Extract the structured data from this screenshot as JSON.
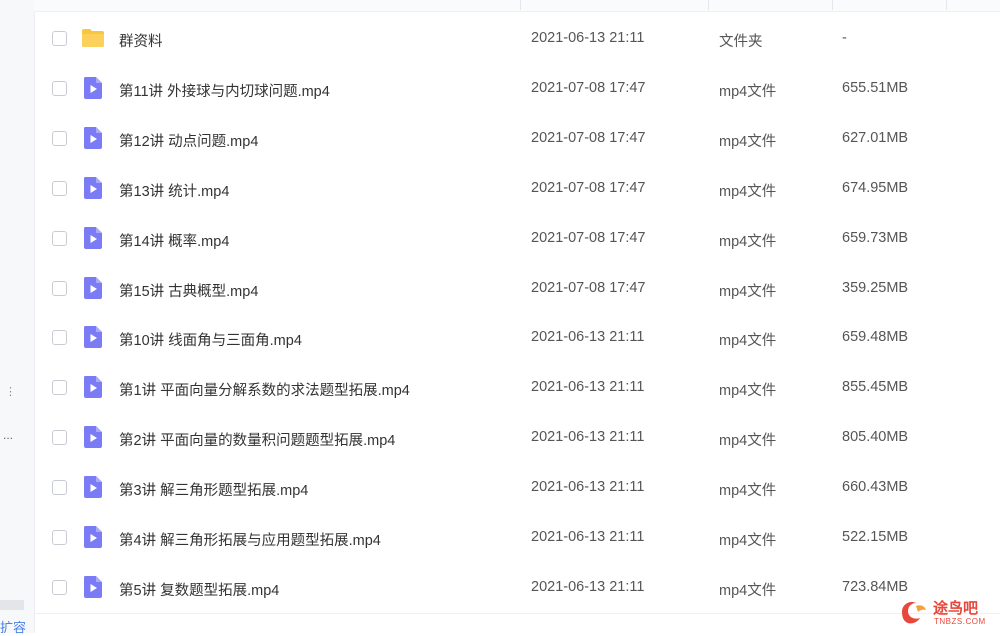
{
  "sidebar": {
    "dots": "⋮",
    "ellipsis": "...",
    "bottom_label": "扩容"
  },
  "files": [
    {
      "name": "群资料",
      "date": "2021-06-13 21:11",
      "type": "文件夹",
      "size": "-",
      "icon": "folder-icon"
    },
    {
      "name": "第11讲 外接球与内切球问题.mp4",
      "date": "2021-07-08 17:47",
      "type": "mp4文件",
      "size": "655.51MB",
      "icon": "video-file-icon"
    },
    {
      "name": "第12讲 动点问题.mp4",
      "date": "2021-07-08 17:47",
      "type": "mp4文件",
      "size": "627.01MB",
      "icon": "video-file-icon"
    },
    {
      "name": "第13讲 统计.mp4",
      "date": "2021-07-08 17:47",
      "type": "mp4文件",
      "size": "674.95MB",
      "icon": "video-file-icon"
    },
    {
      "name": "第14讲 概率.mp4",
      "date": "2021-07-08 17:47",
      "type": "mp4文件",
      "size": "659.73MB",
      "icon": "video-file-icon"
    },
    {
      "name": "第15讲 古典概型.mp4",
      "date": "2021-07-08 17:47",
      "type": "mp4文件",
      "size": "359.25MB",
      "icon": "video-file-icon"
    },
    {
      "name": "第10讲 线面角与三面角.mp4",
      "date": "2021-06-13 21:11",
      "type": "mp4文件",
      "size": "659.48MB",
      "icon": "video-file-icon"
    },
    {
      "name": "第1讲 平面向量分解系数的求法题型拓展.mp4",
      "date": "2021-06-13 21:11",
      "type": "mp4文件",
      "size": "855.45MB",
      "icon": "video-file-icon"
    },
    {
      "name": "第2讲 平面向量的数量积问题题型拓展.mp4",
      "date": "2021-06-13 21:11",
      "type": "mp4文件",
      "size": "805.40MB",
      "icon": "video-file-icon"
    },
    {
      "name": "第3讲 解三角形题型拓展.mp4",
      "date": "2021-06-13 21:11",
      "type": "mp4文件",
      "size": "660.43MB",
      "icon": "video-file-icon"
    },
    {
      "name": "第4讲 解三角形拓展与应用题型拓展.mp4",
      "date": "2021-06-13 21:11",
      "type": "mp4文件",
      "size": "522.15MB",
      "icon": "video-file-icon"
    },
    {
      "name": "第5讲 复数题型拓展.mp4",
      "date": "2021-06-13 21:11",
      "type": "mp4文件",
      "size": "723.84MB",
      "icon": "video-file-icon"
    }
  ],
  "watermark": {
    "title": "途鸟吧",
    "subtitle": "TNBZS.COM"
  },
  "colors": {
    "folder": "#f9c440",
    "video_icon": "#7b7cf5",
    "watermark": "#e8483b"
  }
}
